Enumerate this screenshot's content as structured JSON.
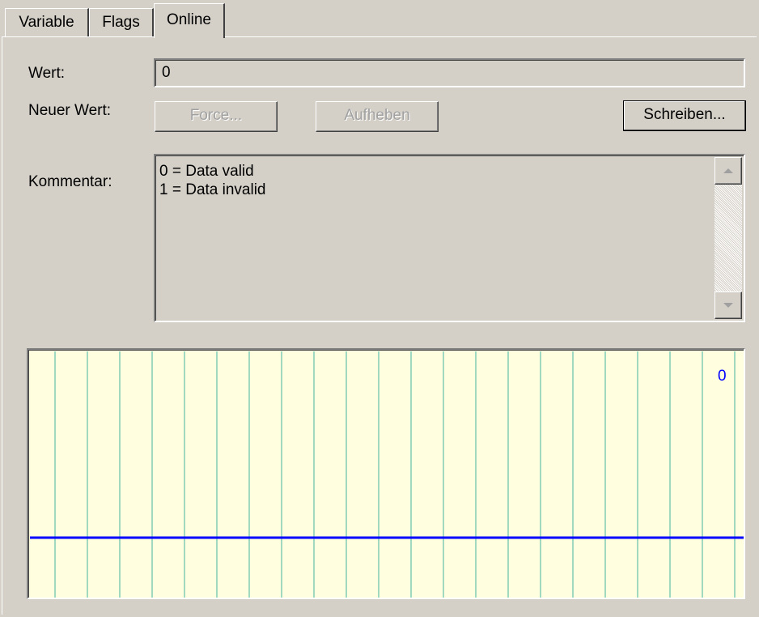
{
  "tabs": [
    {
      "label": "Variable"
    },
    {
      "label": "Flags"
    },
    {
      "label": "Online"
    }
  ],
  "wert": {
    "label": "Wert:",
    "value": "0"
  },
  "neuer_wert": {
    "label": "Neuer Wert:",
    "force_label": "Force...",
    "aufheben_label": "Aufheben",
    "schreiben_label": "Schreiben..."
  },
  "kommentar": {
    "label": "Kommentar:",
    "lines": [
      "0 = Data valid",
      "1 = Data invalid"
    ]
  },
  "chart_data": {
    "type": "line",
    "series": [
      {
        "values": [
          0,
          0,
          0,
          0,
          0,
          0,
          0,
          0,
          0,
          0,
          0,
          0,
          0,
          0,
          0,
          0,
          0,
          0,
          0,
          0,
          0,
          0
        ]
      }
    ],
    "current_value_label": "0",
    "grid": true,
    "colors": {
      "background": "#ffffe0",
      "grid": "#40b0a0",
      "line": "#0000ff",
      "label": "#0000ff"
    }
  }
}
